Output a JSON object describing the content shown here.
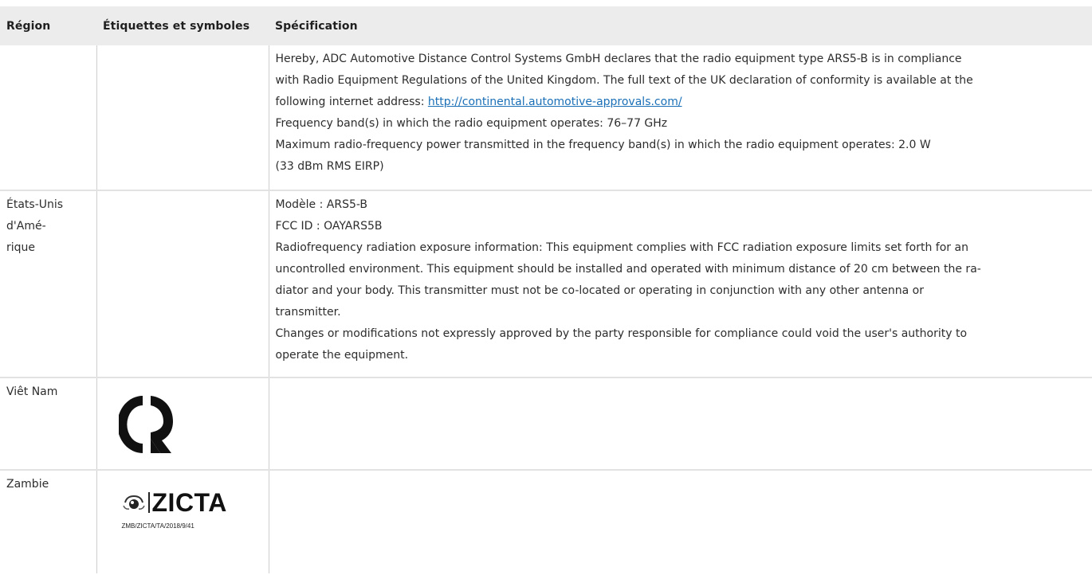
{
  "table": {
    "headers": {
      "region": "Région",
      "labels": "Étiquettes et symboles",
      "spec": "Spécification"
    },
    "rows": [
      {
        "region": "",
        "spec": {
          "l1": "Hereby, ADC Automotive Distance Control Systems GmbH declares that the radio equipment type ARS5-B is in compliance",
          "l2": "with Radio Equipment Regulations of the United Kingdom. The full text of the UK declaration of conformity is available at the",
          "l3_prefix": "following internet address: ",
          "l3_link": "http://continental.automotive-approvals.com/",
          "l4": "Frequency band(s) in which the radio equipment operates: 76–77 GHz",
          "l5": "Maximum radio-frequency power transmitted in the frequency band(s) in which the radio equipment operates: 2.0 W",
          "l6": "(33 dBm RMS EIRP)"
        }
      },
      {
        "region_l1": "États-Unis",
        "region_l2": "d'Amé-",
        "region_l3": "rique",
        "spec": {
          "l1": "Modèle : ARS5-B",
          "l2": "FCC ID : OAYARS5B",
          "l3": "Radiofrequency radiation exposure information: This equipment complies with FCC radiation exposure limits set forth for an",
          "l4": "uncontrolled environment. This equipment should be installed and operated with minimum distance of 20 cm between the ra-",
          "l5": "diator and your body. This transmitter must not be co-located or operating in conjunction with any other antenna or",
          "l6": "transmitter.",
          "l7": "Changes or modifications not expressly approved by the party responsible for compliance could void the user's authority to",
          "l8": "operate the equipment."
        }
      },
      {
        "region": "Viêt Nam",
        "logo_icon": "vietnam-cr-mark-icon"
      },
      {
        "region": "Zambie",
        "logo_icon": "zicta-logo-icon",
        "logo_text": "ZICTA",
        "logo_code": "ZMB/ZICTA/TA/2018/9/41"
      }
    ]
  },
  "colors": {
    "header_bg": "#ececec",
    "link": "#1a6fb7",
    "text": "#2d2d2d"
  }
}
